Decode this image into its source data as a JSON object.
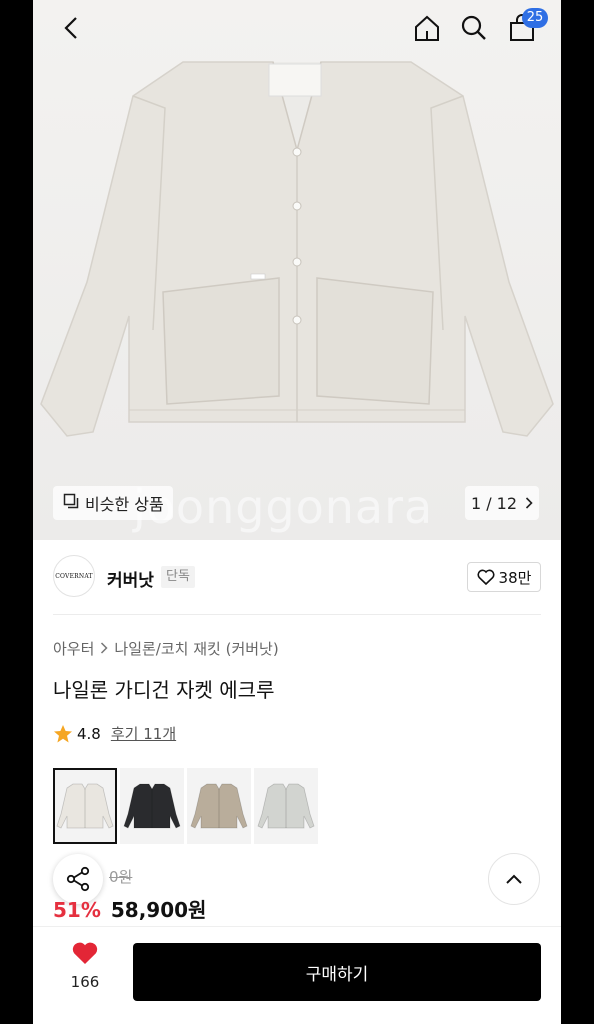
{
  "header": {
    "cart_count": "25",
    "icons": [
      "back-arrow-icon",
      "home-icon",
      "search-icon",
      "shopping-bag-icon"
    ]
  },
  "hero": {
    "watermark": "joonggonara",
    "similar_label": "비슷한 상품",
    "page_indicator": "1 / 12"
  },
  "brand": {
    "logo_text": "COVERNAT",
    "name": "커버낫",
    "tag": "단독",
    "likes": "38만"
  },
  "product": {
    "breadcrumb": [
      "아우터",
      "나일론/코치 재킷 (커버낫)"
    ],
    "title": "나일론 가디건 자켓 에크루",
    "rating": "4.8",
    "reviews": "후기 11개",
    "thumbnails": [
      {
        "name": "ecru",
        "color": "#e9e6e0"
      },
      {
        "name": "black",
        "color": "#2a2b2e"
      },
      {
        "name": "beige",
        "color": "#b9ad9b"
      },
      {
        "name": "light-grey",
        "color": "#d2d4d0"
      }
    ],
    "original_price": "0원",
    "discount": "51%",
    "price": "58,900원"
  },
  "bottom": {
    "wish_count": "166",
    "buy_label": "구매하기"
  },
  "colors": {
    "accent_blue": "#2f6fe4",
    "discount_red": "#e5303f",
    "heart_red": "#e32636",
    "star": "#f5a623"
  }
}
